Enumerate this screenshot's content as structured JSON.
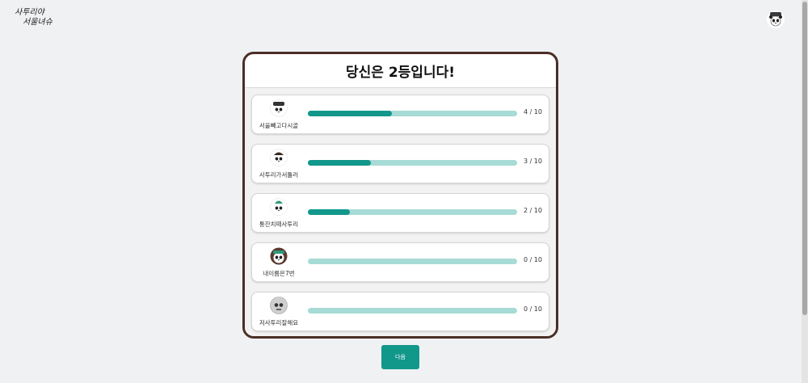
{
  "header": {
    "logo_line1": "사투리야",
    "logo_line2": "서울녀슈"
  },
  "result": {
    "title": "당신은 2등입니다!"
  },
  "players": [
    {
      "name": "서울빼고다시골",
      "score_text": "4 / 10",
      "progress": 0.4,
      "avatar": "panda-icon"
    },
    {
      "name": "사투리가서툴러",
      "score_text": "3 / 10",
      "progress": 0.3,
      "avatar": "panda-icon"
    },
    {
      "name": "퉁잔치때사투리",
      "score_text": "2 / 10",
      "progress": 0.2,
      "avatar": "panda-icon"
    },
    {
      "name": "내이름은7번",
      "score_text": "0 / 10",
      "progress": 0.0,
      "avatar": "panda-icon"
    },
    {
      "name": "저사투리잘해요",
      "score_text": "0 / 10",
      "progress": 0.0,
      "avatar": "skull-icon"
    }
  ],
  "footer": {
    "next_label": "다음"
  },
  "colors": {
    "accent": "#12978b",
    "track": "#a7dbd5",
    "panel_border": "#4a2e26"
  }
}
